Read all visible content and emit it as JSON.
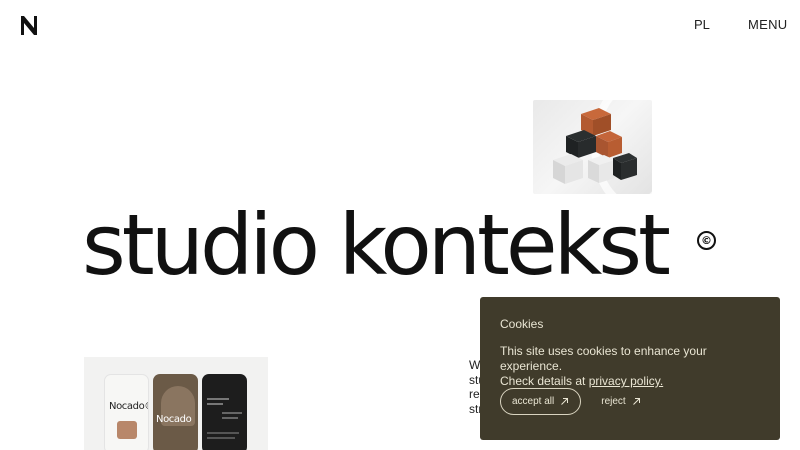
{
  "header": {
    "logo": "N",
    "language": "PL",
    "menu": "MENU"
  },
  "hero": {
    "title": "studio kontekst",
    "copyright": "©"
  },
  "project": {
    "phone_1_text": "Nocado®",
    "phone_2_text": "Nocado"
  },
  "intro": {
    "lines": [
      "We",
      "stu",
      "res",
      "str"
    ]
  },
  "cookies": {
    "title": "Cookies",
    "text": "This site uses cookies to enhance your experience.",
    "text_2_prefix": "Check details at ",
    "policy_link": "privacy policy.",
    "accept_label": "accept all",
    "reject_label": "reject"
  },
  "colors": {
    "banner_bg": "#403b2b",
    "banner_text": "#e9e5d3",
    "text": "#111111"
  }
}
